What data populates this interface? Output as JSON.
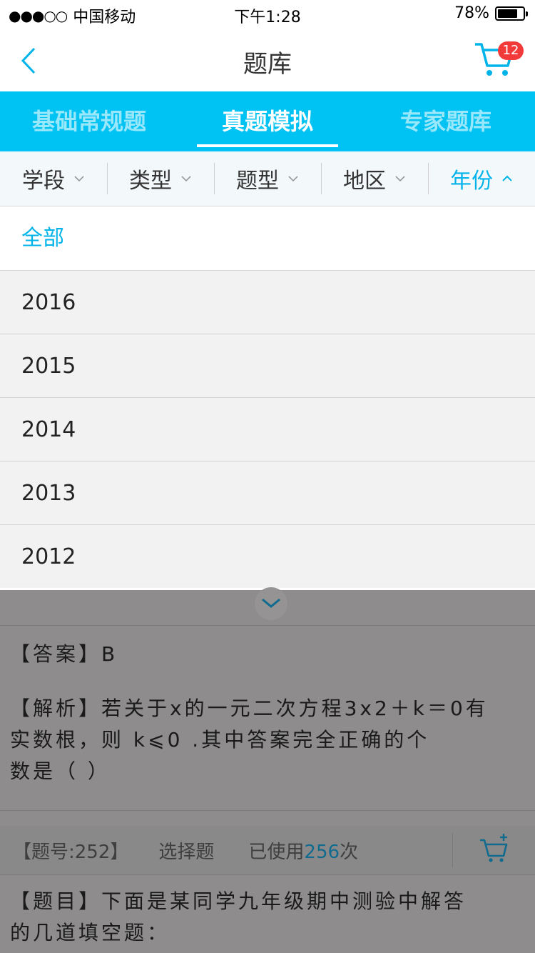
{
  "status_bar": {
    "signal": "●●●○○",
    "carrier": "中国移动",
    "time": "下午1:28",
    "battery": "78%",
    "battery_level": 0.78
  },
  "nav": {
    "title": "题库",
    "cart_count": "12"
  },
  "tabs": [
    {
      "label": "基础常规题",
      "active": false
    },
    {
      "label": "真题模拟",
      "active": true
    },
    {
      "label": "专家题库",
      "active": false
    }
  ],
  "filters": [
    {
      "label": "学段"
    },
    {
      "label": "类型"
    },
    {
      "label": "题型"
    },
    {
      "label": "地区"
    },
    {
      "label": "年份"
    }
  ],
  "year_options": [
    "全部",
    "2016",
    "2015",
    "2014",
    "2013",
    "2012"
  ],
  "background_content": {
    "answer": "【答案】B",
    "analysis_line1": "【解析】若关于x的一元二次方程3x2＋k＝0有",
    "analysis_line2": " 实数根，则  k⩽0    .其中答案完全正确的个",
    "analysis_line3": " 数是（    ）",
    "question_id": "【题号:252】",
    "question_type": "选择题",
    "used_prefix": "已使用",
    "used_count": "256",
    "used_suffix": "次",
    "question_line1": "【题目】下面是某同学九年级期中测验中解答",
    "question_line2": "的几道填空题："
  },
  "colors": {
    "accent": "#00c2f3",
    "accent_text": "#00b4ea",
    "badge": "#f23a3a",
    "overlay": "#8e8c8d"
  }
}
